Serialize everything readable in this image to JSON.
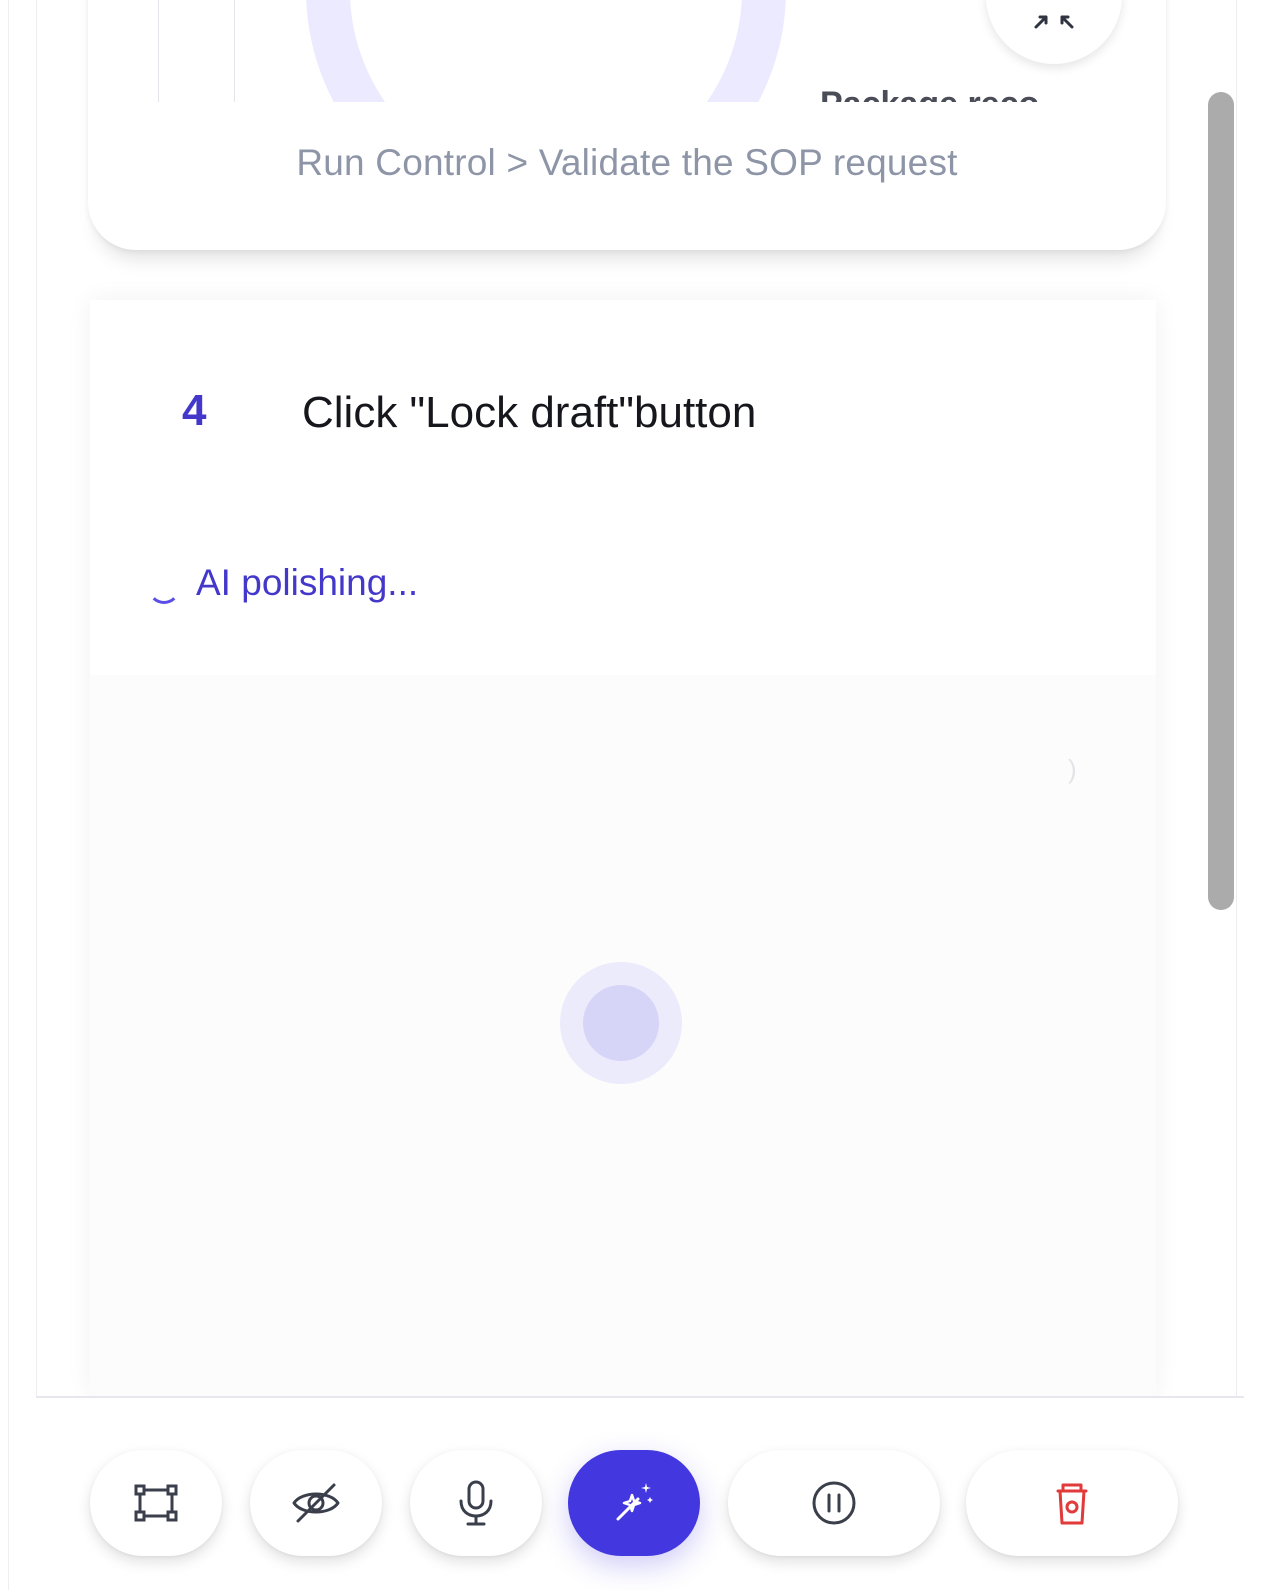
{
  "preview": {
    "heading_partial": "Package reco"
  },
  "breadcrumb": "Run Control > Validate the SOP request",
  "step": {
    "number": "4",
    "text": "Click \"Lock draft\"button"
  },
  "status": {
    "polishing_text": "AI polishing..."
  },
  "toolbar": {
    "buttons": [
      {
        "name": "crop-region",
        "icon": "crop-frame-icon"
      },
      {
        "name": "hide",
        "icon": "eye-off-icon"
      },
      {
        "name": "microphone",
        "icon": "microphone-icon"
      },
      {
        "name": "ai-magic",
        "icon": "sparkle-wand-icon"
      },
      {
        "name": "pause",
        "icon": "pause-circle-icon"
      },
      {
        "name": "delete",
        "icon": "trash-icon"
      }
    ]
  },
  "colors": {
    "accent": "#4338ca",
    "primary_button": "#4338e0",
    "delete": "#e03a3a",
    "muted_text": "#8d95a7",
    "icon": "#3a3f4b"
  }
}
